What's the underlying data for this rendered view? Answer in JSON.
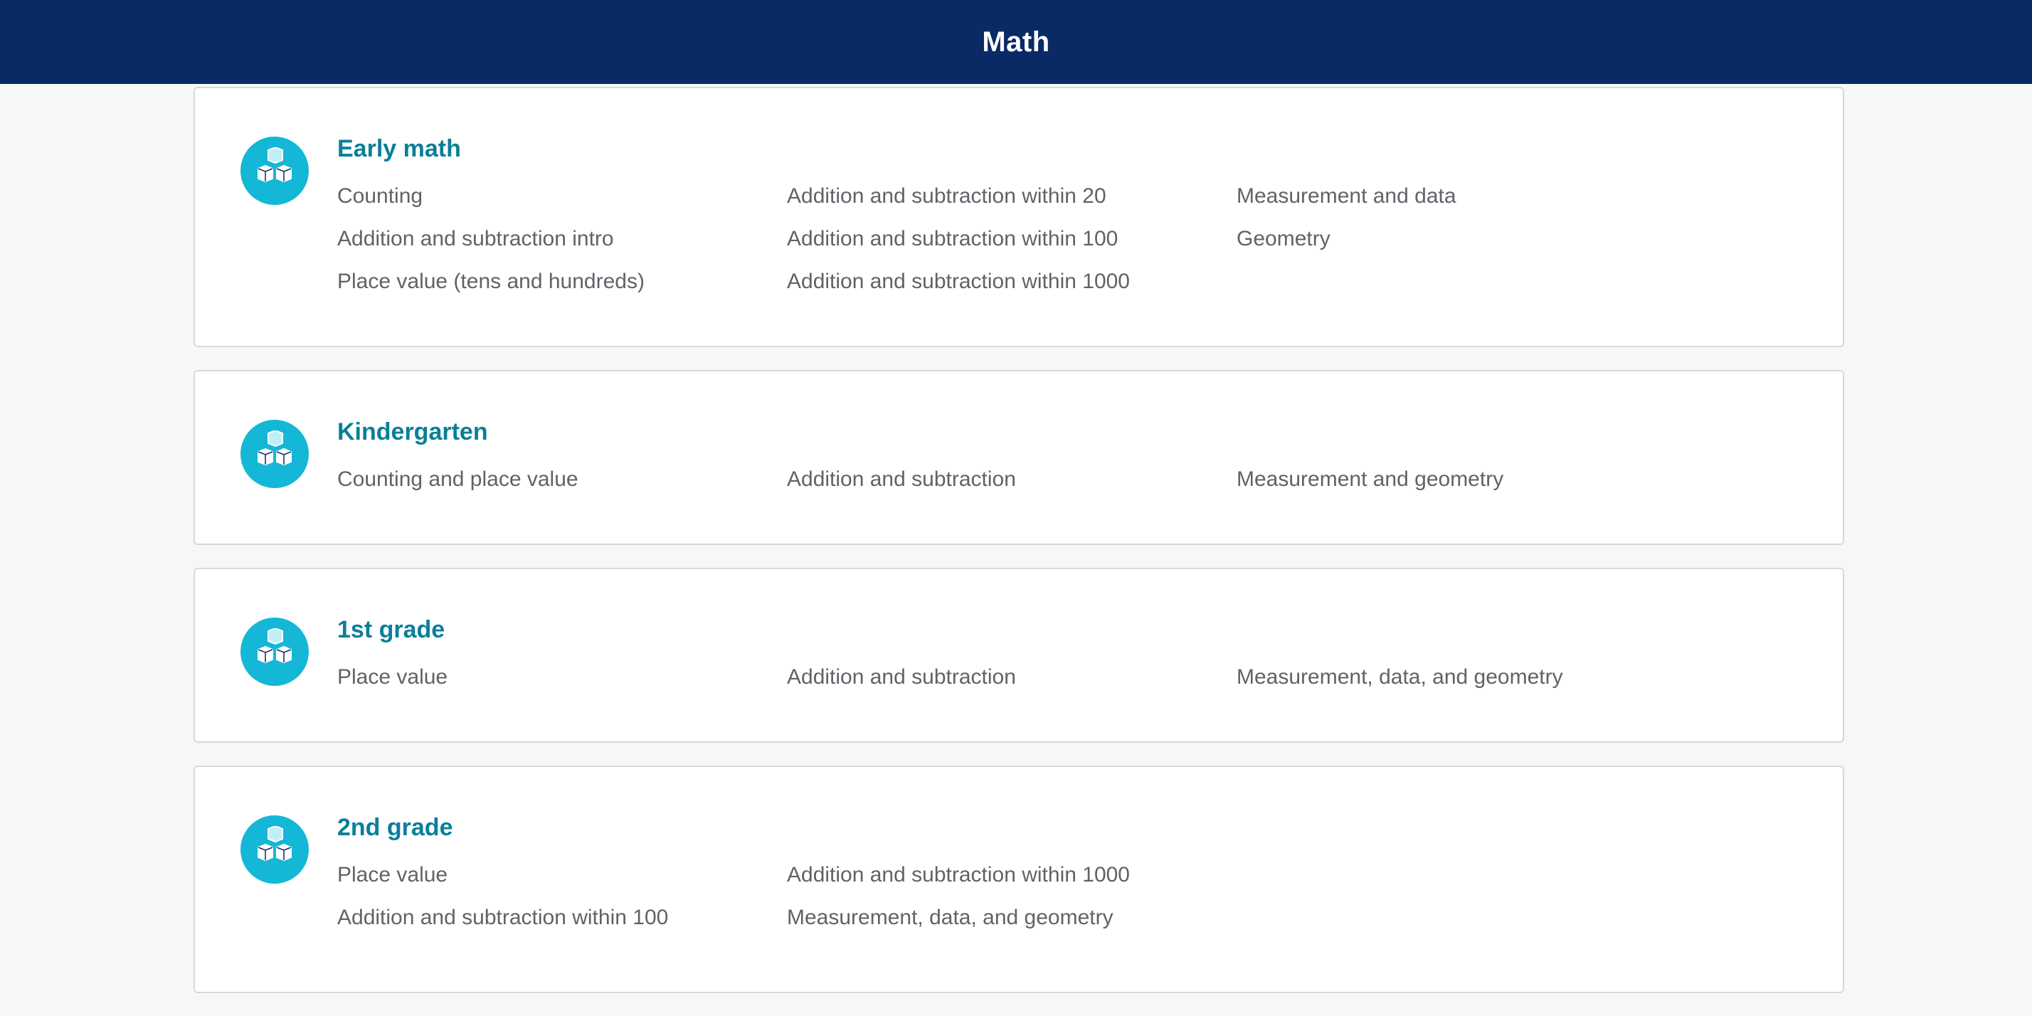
{
  "header": {
    "title": "Math"
  },
  "courses": [
    {
      "title": "Early math",
      "icon": "blocks-icon",
      "topics": [
        "Counting",
        "Addition and subtraction within 20",
        "Measurement and data",
        "Addition and subtraction intro",
        "Addition and subtraction within 100",
        "Geometry",
        "Place value (tens and hundreds)",
        "Addition and subtraction within 1000"
      ]
    },
    {
      "title": "Kindergarten",
      "icon": "blocks-icon",
      "topics": [
        "Counting and place value",
        "Addition and subtraction",
        "Measurement and geometry"
      ]
    },
    {
      "title": "1st grade",
      "icon": "blocks-icon",
      "topics": [
        "Place value",
        "Addition and subtraction",
        "Measurement, data, and geometry"
      ]
    },
    {
      "title": "2nd grade",
      "icon": "blocks-icon",
      "topics": [
        "Place value",
        "Addition and subtraction within 1000",
        "",
        "Addition and subtraction within 100",
        "Measurement, data, and geometry"
      ]
    }
  ],
  "colors": {
    "header_bg": "#0a2a66",
    "accent_title": "#0a7f99",
    "icon_bg": "#14b8d6",
    "topic_text": "#5f6368"
  }
}
